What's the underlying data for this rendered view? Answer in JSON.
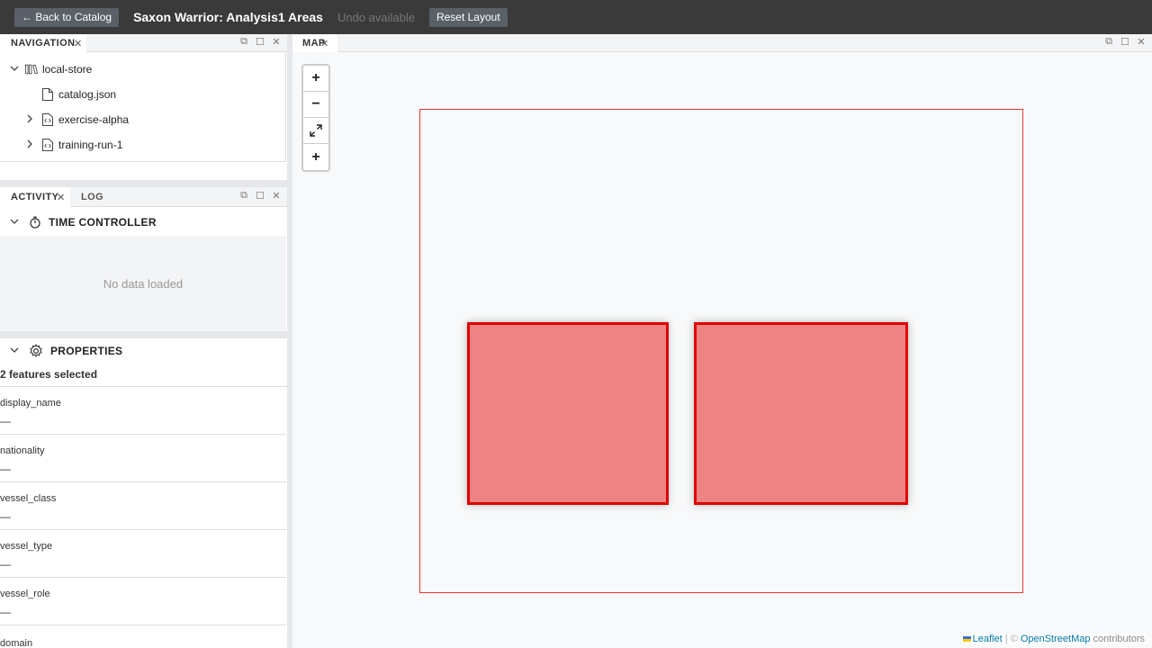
{
  "topbar": {
    "back_label": "← Back to Catalog",
    "title": "Saxon Warrior: Analysis1 Areas",
    "undo_text": "Undo available",
    "reset_label": "Reset Layout"
  },
  "navigation": {
    "tab_label": "NAVIGATION",
    "items": [
      {
        "label": "local-store",
        "icon": "library-icon",
        "expanded": true
      },
      {
        "label": "catalog.json",
        "icon": "file-icon"
      },
      {
        "label": "exercise-alpha",
        "icon": "code-file-icon",
        "expanded": false
      },
      {
        "label": "training-run-1",
        "icon": "code-file-icon",
        "expanded": false
      }
    ]
  },
  "activity": {
    "tabs": [
      "ACTIVITY",
      "LOG"
    ],
    "time_controller": {
      "label": "TIME CONTROLLER",
      "icon": "stopwatch-icon",
      "empty": "No data loaded"
    },
    "properties": {
      "label": "PROPERTIES",
      "icon": "gear-icon",
      "summary": "2 features selected",
      "fields": [
        {
          "name": "display_name",
          "value": "—"
        },
        {
          "name": "nationality",
          "value": "—"
        },
        {
          "name": "vessel_class",
          "value": "—"
        },
        {
          "name": "vessel_type",
          "value": "—"
        },
        {
          "name": "vessel_role",
          "value": "—"
        },
        {
          "name": "domain",
          "value": ""
        }
      ]
    }
  },
  "map": {
    "tab_label": "MAP",
    "controls": [
      "+",
      "−",
      "⤢",
      "+"
    ],
    "attribution": {
      "leaflet": "Leaflet",
      "separator": " | © ",
      "osm": "OpenStreetMap",
      "suffix": " contributors"
    },
    "colors": {
      "boundary": "#e53935",
      "feature_stroke": "#e00000",
      "feature_fill": "#f08080"
    }
  }
}
